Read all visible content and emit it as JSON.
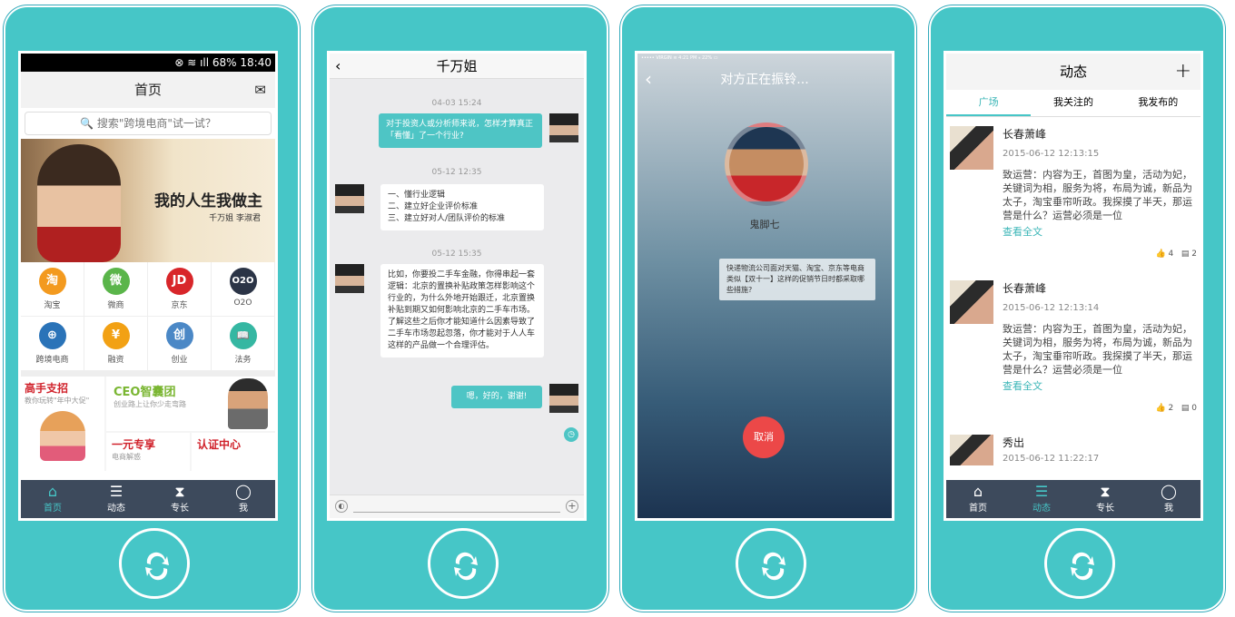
{
  "screen1": {
    "status": {
      "icons": "⊗ ≋ ıll",
      "battery": "68%",
      "time": "18:40"
    },
    "nav_title": "首页",
    "mail_icon": "mail-icon",
    "search_placeholder": "搜索\"跨境电商\"试一试？",
    "banner": {
      "title": "我的人生我做主",
      "subtitle": "千万姐 李淑君"
    },
    "grid": [
      {
        "label": "淘宝",
        "glyph": "淘",
        "color": "#f39a1f"
      },
      {
        "label": "微商",
        "glyph": "微",
        "color": "#5ab54a"
      },
      {
        "label": "京东",
        "glyph": "JD",
        "color": "#d8262a"
      },
      {
        "label": "O2O",
        "glyph": "O2O",
        "color": "#2b3446"
      },
      {
        "label": "跨境电商",
        "glyph": "⊕",
        "color": "#2a73b8"
      },
      {
        "label": "融资",
        "glyph": "¥",
        "color": "#f2a114"
      },
      {
        "label": "创业",
        "glyph": "创",
        "color": "#4b88c6"
      },
      {
        "label": "法务",
        "glyph": "📖",
        "color": "#35b7a2"
      }
    ],
    "promo": {
      "a_title": "高手支招",
      "a_sub": "教你玩转\"年中大促\"",
      "b_title": "CEO智囊团",
      "b_sub": "创业路上让你少走弯路",
      "c_title": "一元专享",
      "c_sub": "电商解惑",
      "d_title": "认证中心"
    },
    "tabs": [
      "首页",
      "动态",
      "专长",
      "我"
    ]
  },
  "screen2": {
    "title": "千万姐",
    "messages": [
      {
        "time": "04-03 15:24",
        "text": "对于投资人或分析师来说，怎样才算真正「看懂」了一个行业?"
      },
      {
        "time": "05-12 12:35",
        "lines": [
          "一、懂行业逻辑",
          "二、建立好企业评价标准",
          "三、建立好对人/团队评价的标准"
        ]
      },
      {
        "time": "05-12 15:35",
        "text": "比如，你要投二手车金融，你得串起一套逻辑：北京的置换补贴政策怎样影响这个行业的，为什么外地开始跟迁，北京置换补贴到期又如何影响北京的二手车市场。了解这些之后你才能知道什么因素导致了二手车市场忽起忽落，你才能对于人人车这样的产品做一个合理评估。"
      },
      {
        "text": "嗯，好的，谢谢!"
      }
    ]
  },
  "screen3": {
    "status": "••••• VIRGIN ≋   4:21 PM   ⁎ 22% ▭",
    "title": "对方正在振铃...",
    "name": "鬼脚七",
    "message": "快递物流公司面对天猫、淘宝、京东等电商类似【双十一】这样的促销节日时都采取哪些措施?",
    "cancel": "取消"
  },
  "screen4": {
    "title": "动态",
    "tabs": [
      "广场",
      "我关注的",
      "我发布的"
    ],
    "posts": [
      {
        "name": "长春萧峰",
        "time": "2015-06-12 12:13:15",
        "body": "致运营：内容为王，首图为皇，活动为妃，关键词为相，服务为将，布局为诚，新品为太子，淘宝垂帘听政。我探摸了半天，那运营是什么？运营必须是一位",
        "more": "查看全文",
        "likes": "4",
        "comments": "2"
      },
      {
        "name": "长春萧峰",
        "time": "2015-06-12 12:13:14",
        "body": "致运营：内容为王，首图为皇，活动为妃，关键词为相，服务为将，布局为诚，新品为太子，淘宝垂帘听政。我探摸了半天，那运营是什么？运营必须是一位",
        "more": "查看全文",
        "likes": "2",
        "comments": "0"
      },
      {
        "name": "秀出",
        "time": "2015-06-12 11:22:17"
      }
    ],
    "bottom_tabs": [
      "首页",
      "动态",
      "专长",
      "我"
    ]
  }
}
